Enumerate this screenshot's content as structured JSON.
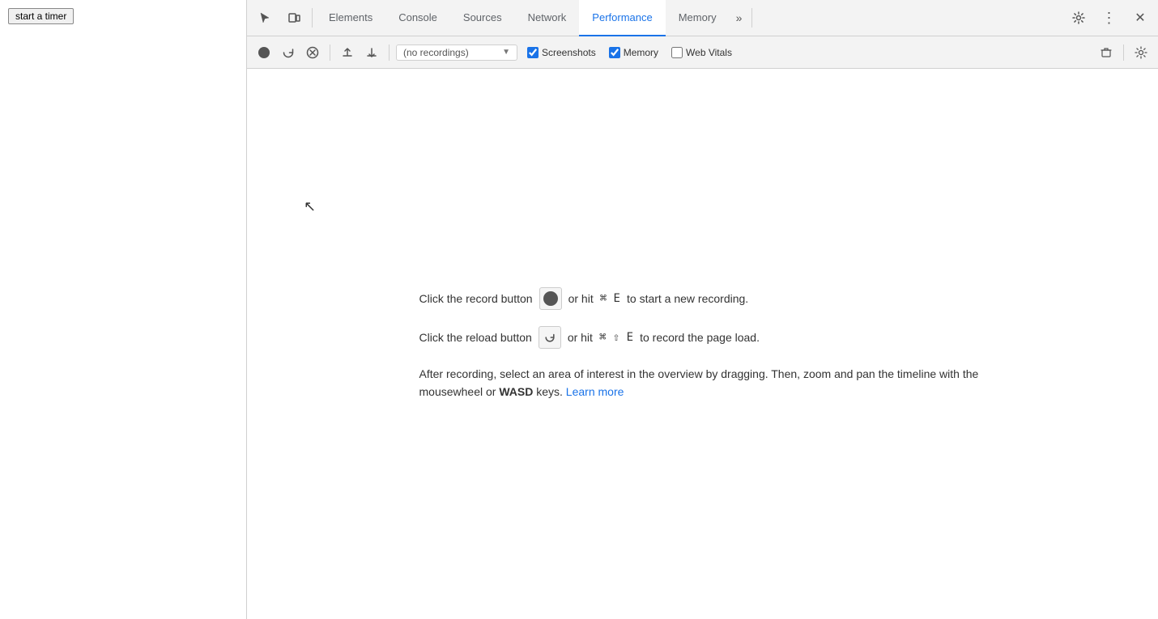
{
  "page": {
    "start_timer_label": "start a timer"
  },
  "devtools": {
    "tabs": [
      {
        "id": "elements",
        "label": "Elements",
        "active": false
      },
      {
        "id": "console",
        "label": "Console",
        "active": false
      },
      {
        "id": "sources",
        "label": "Sources",
        "active": false
      },
      {
        "id": "network",
        "label": "Network",
        "active": false
      },
      {
        "id": "performance",
        "label": "Performance",
        "active": true
      },
      {
        "id": "memory",
        "label": "Memory",
        "active": false
      }
    ],
    "toolbar": {
      "recordings_placeholder": "(no recordings)",
      "screenshots_label": "Screenshots",
      "memory_label": "Memory",
      "web_vitals_label": "Web Vitals",
      "screenshots_checked": true,
      "memory_checked": true,
      "web_vitals_checked": false
    },
    "instructions": {
      "record_line1": "Click the record button",
      "record_line1_mid": "or hit",
      "record_line1_shortcut": "⌘ E",
      "record_line1_end": "to start a new recording.",
      "reload_line1": "Click the reload button",
      "reload_line1_mid": "or hit",
      "reload_line1_shortcut": "⌘ ⇧ E",
      "reload_line1_end": "to record the page load.",
      "after_text_start": "After recording, select an area of interest in the overview by dragging. Then, zoom and pan the timeline with the mousewheel or ",
      "after_text_bold": "WASD",
      "after_text_end": " keys.",
      "learn_more_label": "Learn more",
      "learn_more_href": "#"
    }
  }
}
